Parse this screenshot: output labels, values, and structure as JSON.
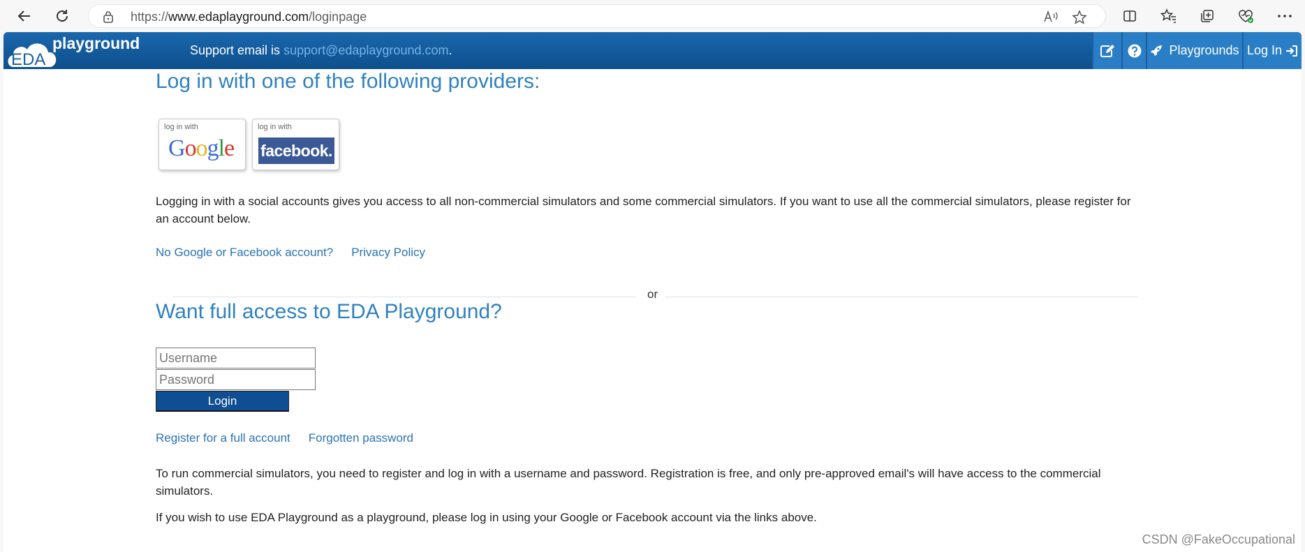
{
  "browser": {
    "url_prefix": "https://",
    "url_domain": "www.edaplayground.com",
    "url_path": "/loginpage"
  },
  "header": {
    "logo_text": "playground",
    "logo_badge": "EDA",
    "support_prefix": "Support email is ",
    "support_email": "support@edaplayground.com",
    "support_suffix": ".",
    "nav_playgrounds": "Playgrounds",
    "nav_login": "Log In"
  },
  "providers": {
    "heading": "Log in with one of the following providers:",
    "google_small": "log in with",
    "facebook_small": "log in with",
    "facebook_label": "facebook.",
    "info": "Logging in with a social accounts gives you access to all non-commercial simulators and some commercial simulators. If you want to use all the commercial simulators, please register for an account below.",
    "link_no_account": "No Google or Facebook account?",
    "link_privacy": "Privacy Policy"
  },
  "divider_text": "or",
  "full_access": {
    "heading": "Want full access to EDA Playground?",
    "username_placeholder": "Username",
    "password_placeholder": "Password",
    "login_label": "Login",
    "link_register": "Register for a full account",
    "link_forgot": "Forgotten password",
    "note1": "To run commercial simulators, you need to register and log in with a username and password. Registration is free, and only pre-approved email's will have access to the commercial simulators.",
    "note2": "If you wish to use EDA Playground as a playground, please log in using your Google or Facebook account via the links above."
  },
  "watermark": "CSDN @FakeOccupational",
  "colors": {
    "topbar": "#0d4f8c",
    "heading": "#2f81bf",
    "link": "#2a73b3",
    "facebook": "#3b5997"
  }
}
